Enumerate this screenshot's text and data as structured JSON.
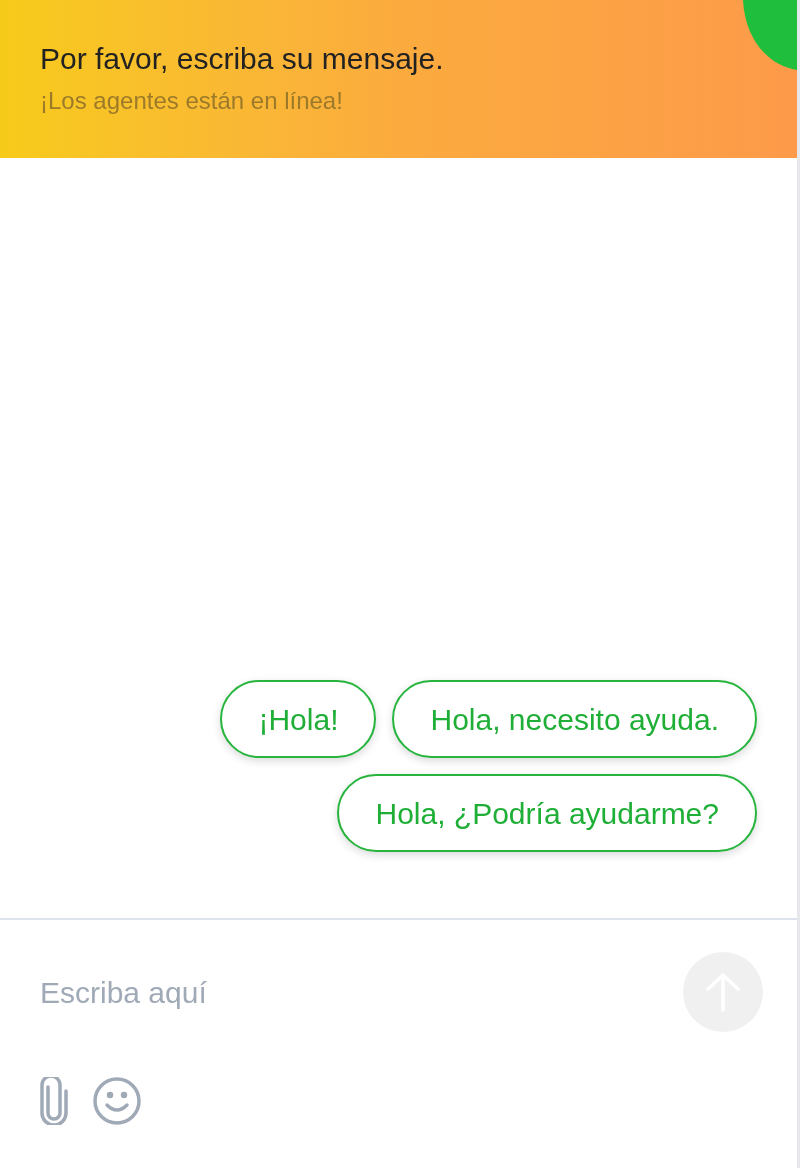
{
  "header": {
    "title": "Por favor, escriba su mensaje.",
    "subtitle": "¡Los agentes están en línea!"
  },
  "quick_replies": [
    {
      "label": "¡Hola!"
    },
    {
      "label": "Hola, necesito ayuda."
    },
    {
      "label": "Hola, ¿Podría ayudarme?"
    }
  ],
  "composer": {
    "placeholder": "Escriba aquí",
    "send_disabled": true
  }
}
